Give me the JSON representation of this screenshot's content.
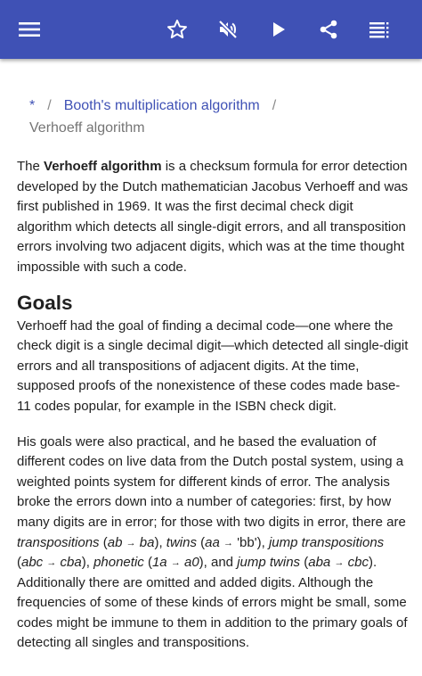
{
  "toolbar": {
    "menu_icon": "menu-icon",
    "favorite_icon": "star-outline-icon",
    "mute_icon": "volume-off-icon",
    "play_icon": "play-icon",
    "share_icon": "share-icon",
    "toc_icon": "list-icon",
    "background_color": "#3f51b5"
  },
  "breadcrumb": {
    "home": "*",
    "separator": "/",
    "parent": "Booth's multiplication algorithm",
    "current": "Verhoeff algorithm",
    "link_color": "#3f51b5"
  },
  "article": {
    "intro_bold": "Verhoeff algorithm",
    "intro_before": "The ",
    "intro_rest": " is a checksum formula for error detection developed by the Dutch mathematician Jacobus Verhoeff and was first published in 1969. It was the first decimal check digit algorithm which detects all single-digit errors, and all transposition errors involving two adjacent digits, which was at the time thought impossible with such a code.",
    "goals_heading": "Goals",
    "goals_p1": "Verhoeff had the goal of finding a decimal code—one where the check digit is a single decimal digit—which detected all single-digit errors and all transpositions of adjacent digits. At the time, supposed proofs of the nonexistence of these codes made base-11 codes popular, for example in the ISBN check digit.",
    "goals_p2": {
      "t1": "His goals were also practical, and he based the evaluation of different codes on live data from the Dutch postal system, using a weighted points system for different kinds of error. The analysis broke the errors down into a number of categories: first, by how many digits are in error; for those with two digits in error, there are ",
      "transpositions": "transpositions",
      "ex1_a": "ab",
      "ex1_b": "ba",
      "twins": "twins",
      "ex2_a": "aa",
      "ex2_b": "'bb'",
      "jump_transpositions": "jump transpositions",
      "ex3_a": "abc",
      "ex3_b": "cba",
      "phonetic": "phonetic",
      "ex4_a": "1a",
      "ex4_b": "a0",
      "jump_twins": "jump twins",
      "ex5_a": "aba",
      "ex5_b": "cbc",
      "arrow": "→",
      "t2": ". Additionally there are omitted and added digits. Although the frequencies of some of these kinds of errors might be small, some codes might be immune to them in addition to the primary goals of detecting all singles and transpositions."
    }
  }
}
